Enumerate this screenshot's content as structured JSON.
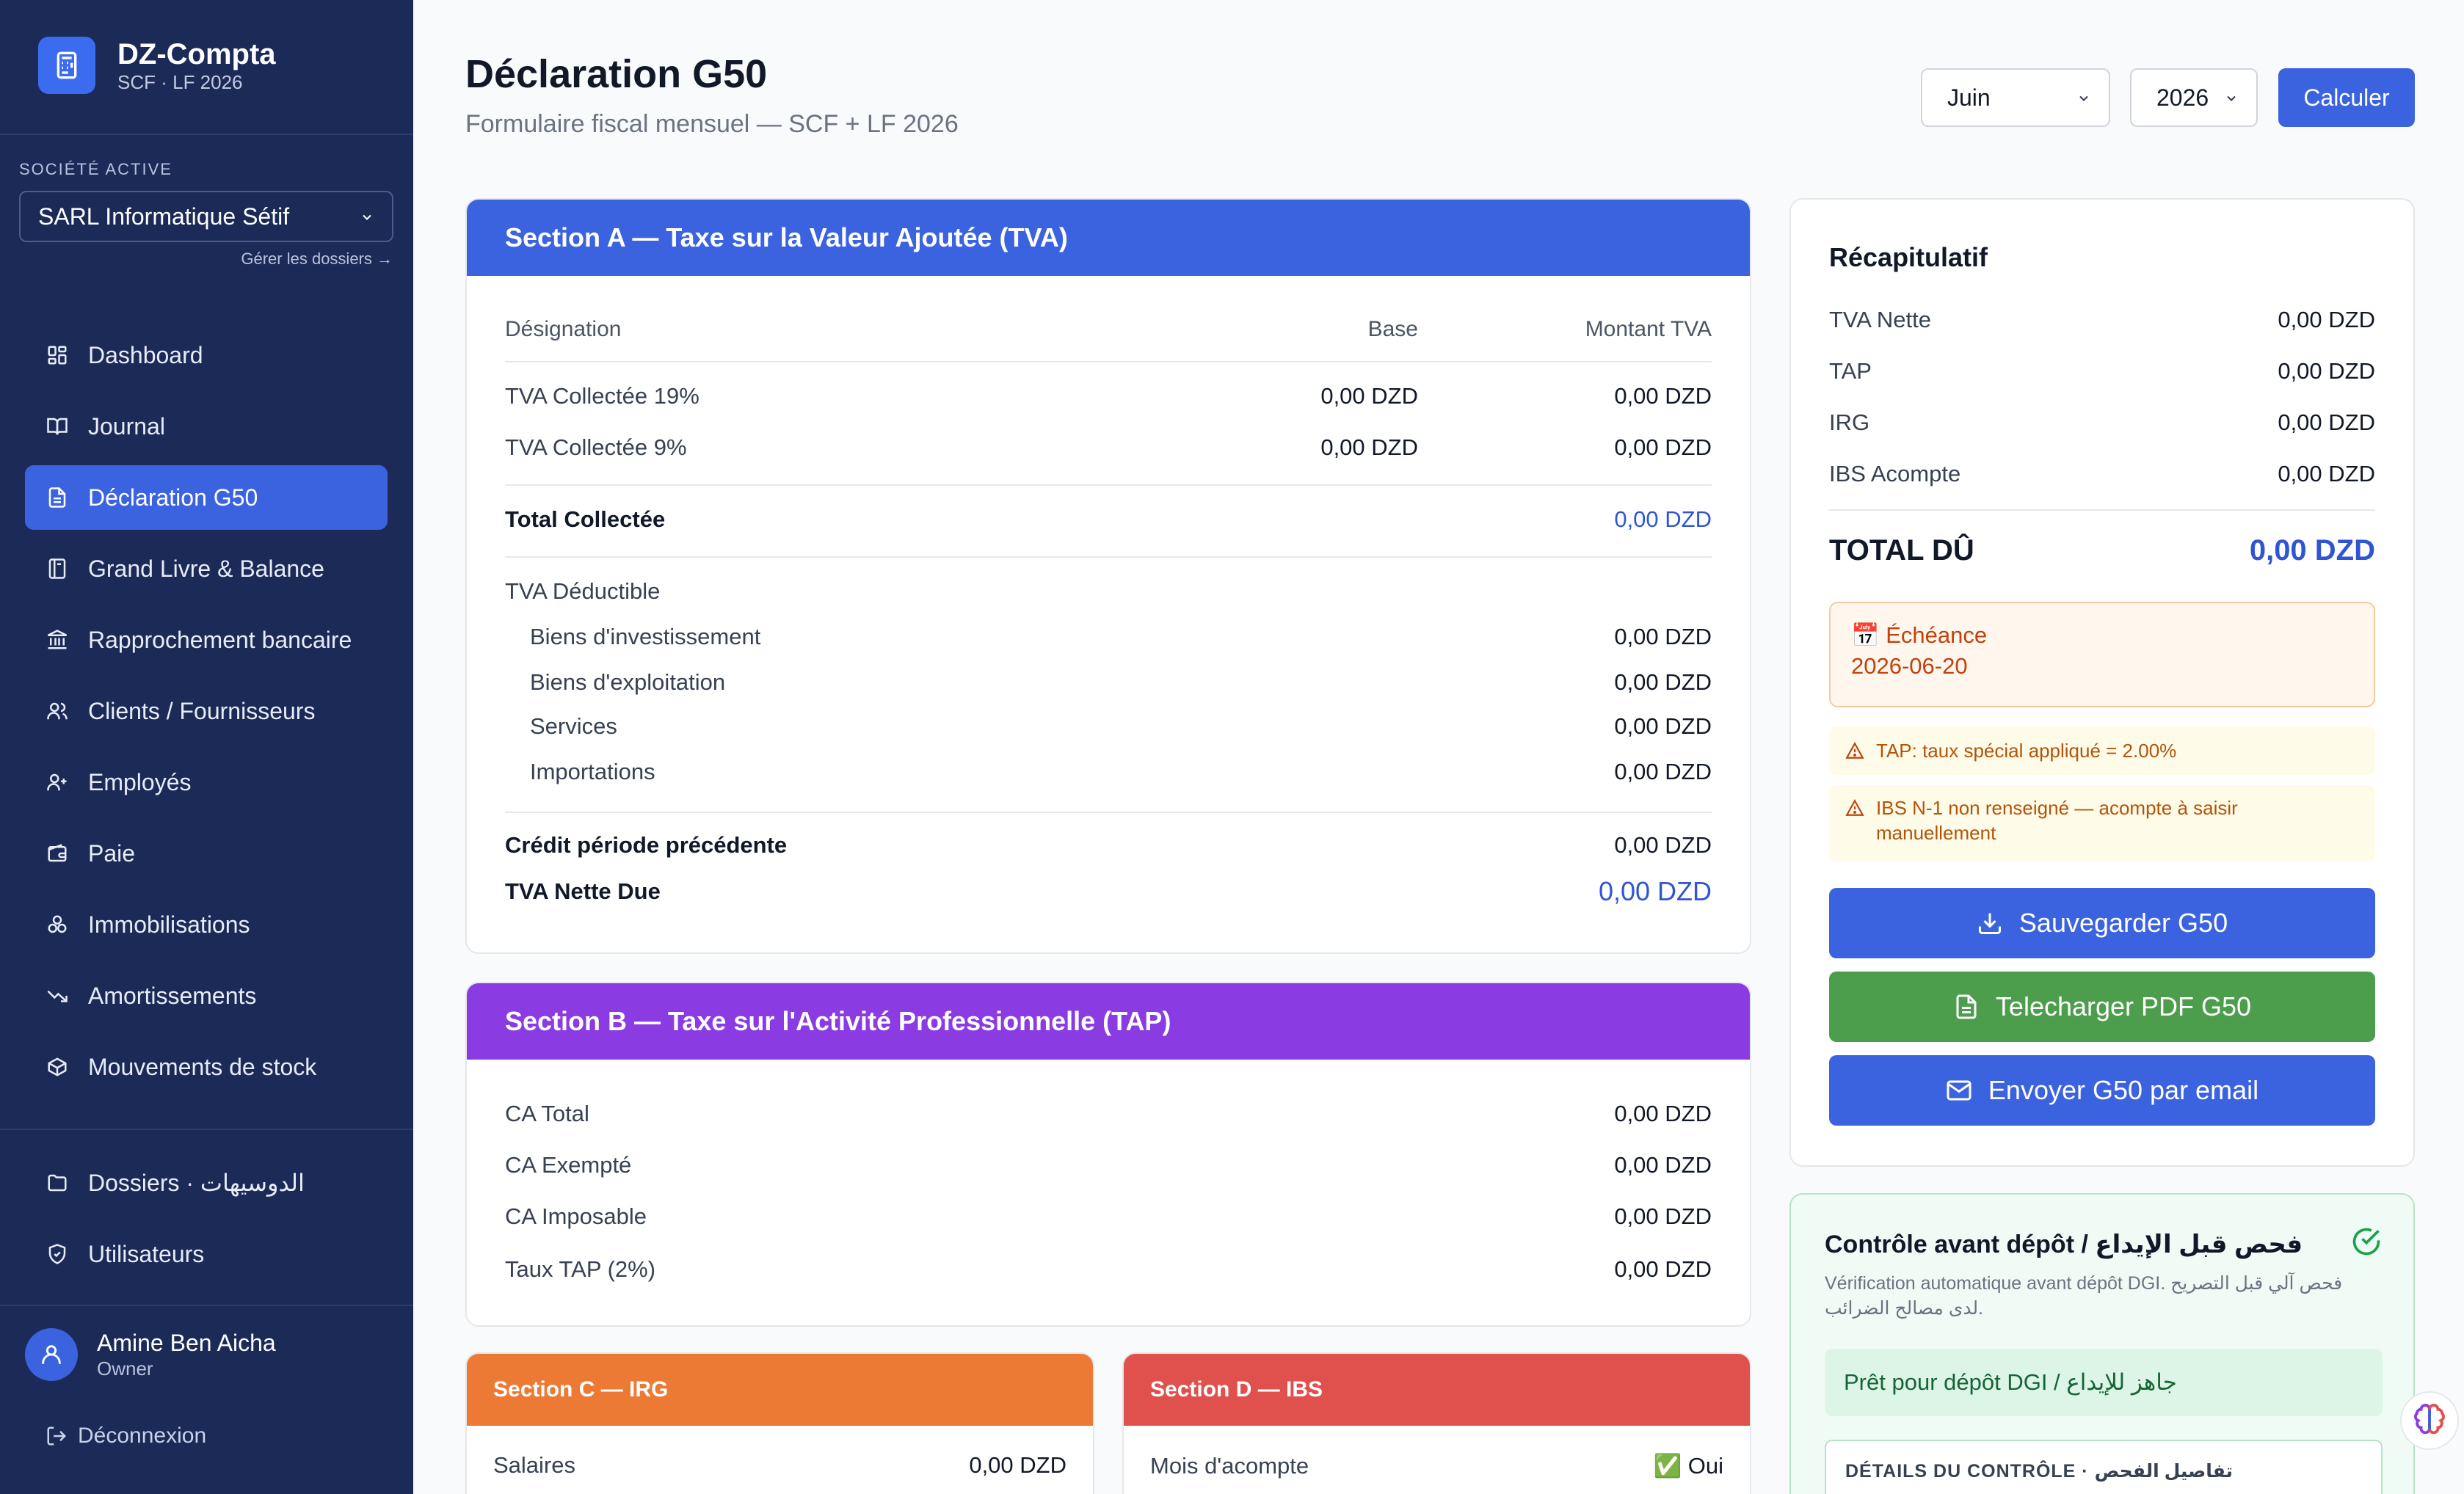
{
  "app": {
    "name": "DZ-Compta",
    "subtitle": "SCF · LF 2026"
  },
  "company": {
    "label": "SOCIÉTÉ ACTIVE",
    "selected": "SARL Informatique Sétif",
    "manage_link": "Gérer les dossiers →"
  },
  "nav": {
    "items": [
      {
        "label": "Dashboard",
        "icon": "dashboard-icon"
      },
      {
        "label": "Journal",
        "icon": "book-icon"
      },
      {
        "label": "Déclaration G50",
        "icon": "document-icon",
        "active": true
      },
      {
        "label": "Grand Livre & Balance",
        "icon": "ledger-icon"
      },
      {
        "label": "Rapprochement bancaire",
        "icon": "bank-icon"
      },
      {
        "label": "Clients / Fournisseurs",
        "icon": "users-icon"
      },
      {
        "label": "Employés",
        "icon": "user-plus-icon"
      },
      {
        "label": "Paie",
        "icon": "wallet-icon"
      },
      {
        "label": "Immobilisations",
        "icon": "assets-icon"
      },
      {
        "label": "Amortissements",
        "icon": "trend-down-icon"
      },
      {
        "label": "Mouvements de stock",
        "icon": "box-icon"
      }
    ],
    "secondary": [
      {
        "label": "Dossiers · الدوسيهات",
        "icon": "folder-icon"
      },
      {
        "label": "Utilisateurs",
        "icon": "shield-icon"
      }
    ]
  },
  "user": {
    "name": "Amine Ben Aicha",
    "role": "Owner",
    "logout": "Déconnexion"
  },
  "header": {
    "title": "Déclaration G50",
    "subtitle": "Formulaire fiscal mensuel — SCF + LF 2026",
    "month": "Juin",
    "year": "2026",
    "calculate": "Calculer"
  },
  "sectionA": {
    "title": "Section A — Taxe sur la Valeur Ajoutée (TVA)",
    "columns": [
      "Désignation",
      "Base",
      "Montant TVA"
    ],
    "collected": [
      {
        "label": "TVA Collectée 19%",
        "base": "0,00 DZD",
        "amount": "0,00 DZD"
      },
      {
        "label": "TVA Collectée 9%",
        "base": "0,00 DZD",
        "amount": "0,00 DZD"
      }
    ],
    "total_collected": {
      "label": "Total Collectée",
      "amount": "0,00 DZD"
    },
    "deductible_title": "TVA Déductible",
    "deductible": [
      {
        "label": "Biens d'investissement",
        "amount": "0,00 DZD"
      },
      {
        "label": "Biens d'exploitation",
        "amount": "0,00 DZD"
      },
      {
        "label": "Services",
        "amount": "0,00 DZD"
      },
      {
        "label": "Importations",
        "amount": "0,00 DZD"
      }
    ],
    "previous_credit": {
      "label": "Crédit période précédente",
      "amount": "0,00 DZD"
    },
    "net_due": {
      "label": "TVA Nette Due",
      "amount": "0,00 DZD"
    }
  },
  "sectionB": {
    "title": "Section B — Taxe sur l'Activité Professionnelle (TAP)",
    "rows": [
      {
        "label": "CA Total",
        "amount": "0,00 DZD"
      },
      {
        "label": "CA Exempté",
        "amount": "0,00 DZD"
      },
      {
        "label": "CA Imposable",
        "amount": "0,00 DZD"
      },
      {
        "label": "Taux TAP (2%)",
        "amount": "0,00 DZD"
      }
    ]
  },
  "sectionC": {
    "title": "Section C — IRG",
    "row": {
      "label": "Salaires",
      "amount": "0,00 DZD"
    }
  },
  "sectionD": {
    "title": "Section D — IBS",
    "row": {
      "label": "Mois d'acompte",
      "amount": "✅ Oui"
    }
  },
  "summary": {
    "title": "Récapitulatif",
    "rows": [
      {
        "label": "TVA Nette",
        "amount": "0,00 DZD"
      },
      {
        "label": "TAP",
        "amount": "0,00 DZD"
      },
      {
        "label": "IRG",
        "amount": "0,00 DZD"
      },
      {
        "label": "IBS Acompte",
        "amount": "0,00 DZD"
      }
    ],
    "total_label": "TOTAL DÛ",
    "total_amount": "0,00 DZD",
    "deadline_label": "📅 Échéance",
    "deadline_date": "2026-06-20",
    "warnings": [
      "TAP: taux spécial appliqué = 2.00%",
      "IBS N-1 non renseigné — acompte à saisir manuellement"
    ],
    "save_button": "Sauvegarder G50",
    "pdf_button": "Telecharger PDF G50",
    "email_button": "Envoyer G50 par email"
  },
  "control": {
    "title": "Contrôle avant dépôt / فحص قبل الإيداع",
    "description": "Vérification automatique avant dépôt DGI. فحص آلي قبل التصريح لدى مصالح الضرائب.",
    "status": "Prêt pour dépôt DGI / جاهز للإيداع",
    "details": "DÉTAILS DU CONTRÔLE · تفاصيل الفحص"
  },
  "colors": {
    "sidebar": "#1c2a57",
    "primary": "#3b63e0",
    "sectionA": "#3b63e0",
    "sectionB": "#8b3be2",
    "sectionC": "#ec7a34",
    "sectionD": "#e0504d",
    "pdf_button": "#4c9e4d"
  }
}
